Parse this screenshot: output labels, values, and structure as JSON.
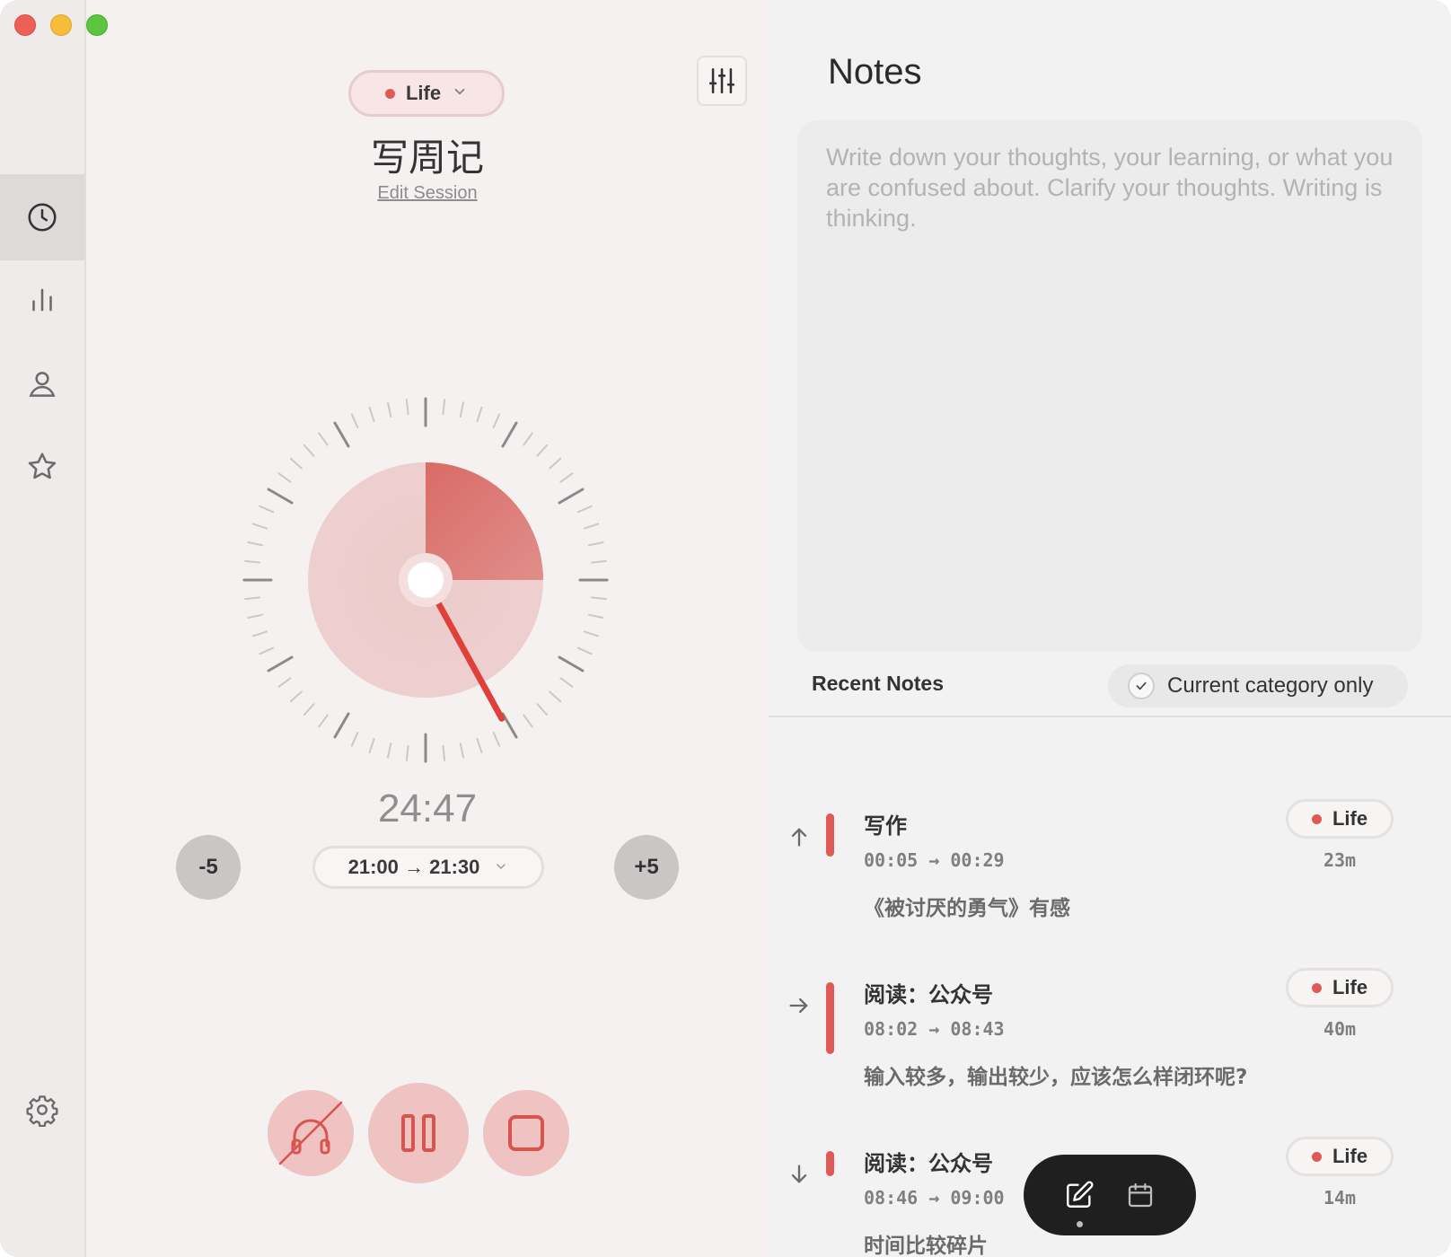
{
  "window": {
    "controls": [
      "close",
      "minimize",
      "maximize"
    ]
  },
  "sidebar": {
    "items": [
      {
        "icon": "clock-icon",
        "active": true
      },
      {
        "icon": "bar-chart-icon",
        "active": false
      },
      {
        "icon": "person-icon",
        "active": false
      },
      {
        "icon": "star-icon",
        "active": false
      }
    ],
    "settings_icon": "gear-icon"
  },
  "timer": {
    "category": {
      "label": "Life",
      "color": "#e05a55"
    },
    "session_title": "写周记",
    "edit_link": "Edit Session",
    "remaining": "24:47",
    "decrement_label": "-5",
    "increment_label": "+5",
    "range": {
      "start": "21:00",
      "arrow": "→",
      "end": "21:30"
    },
    "elapsed_fraction": 0.25,
    "hand_fraction": 0.42,
    "controls": [
      "headphones-off-icon",
      "pause-icon",
      "stop-icon"
    ]
  },
  "notes": {
    "title": "Notes",
    "placeholder": "Write down your thoughts, your learning, or what you are confused about. Clarify your thoughts. Writing is thinking.",
    "recent_title": "Recent Notes",
    "filter_label": "Current category only",
    "items": [
      {
        "direction": "up",
        "title": "写作",
        "start": "00:05",
        "arrow": "→",
        "end": "00:29",
        "text": "《被讨厌的勇气》有感",
        "category": "Life",
        "duration": "23m"
      },
      {
        "direction": "right",
        "title": "阅读：公众号",
        "start": "08:02",
        "arrow": "→",
        "end": "08:43",
        "text": "输入较多，输出较少，应该怎么样闭环呢?",
        "category": "Life",
        "duration": "40m"
      },
      {
        "direction": "down",
        "title": "阅读：公众号",
        "start": "08:46",
        "arrow": "→",
        "end": "09:00",
        "text": "时间比较碎片",
        "category": "Life",
        "duration": "14m"
      }
    ]
  },
  "fab": {
    "items": [
      "edit-note-icon",
      "calendar-icon"
    ]
  },
  "colors": {
    "accent": "#e05a55",
    "accent_light": "#eec3c2",
    "sidebar_bg": "#eeebea"
  }
}
